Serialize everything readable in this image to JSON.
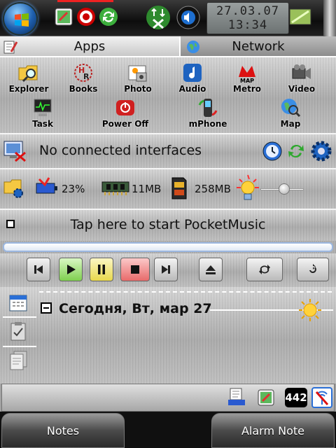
{
  "status_bar": {
    "date": "27.03.07",
    "time": "13:34"
  },
  "tabs": [
    {
      "label": "Apps",
      "icon": "notepad-icon",
      "selected": true
    },
    {
      "label": "Network",
      "icon": "globe-icon",
      "selected": false
    }
  ],
  "apps": [
    {
      "label": "Explorer",
      "icon": "folder-search-icon"
    },
    {
      "label": "Books",
      "icon": "books-icon"
    },
    {
      "label": "Photo",
      "icon": "photo-icon"
    },
    {
      "label": "Audio",
      "icon": "audio-note-icon"
    },
    {
      "label": "Metro",
      "icon": "metro-map-icon"
    },
    {
      "label": "Video",
      "icon": "video-camera-icon"
    },
    {
      "label": "Task",
      "icon": "task-manager-icon"
    },
    {
      "label": "Power Off",
      "icon": "power-icon"
    },
    {
      "label": "mPhone",
      "icon": "phone-icon"
    },
    {
      "label": "Map",
      "icon": "map-globe-icon"
    }
  ],
  "network": {
    "status_text": "No connected interfaces"
  },
  "system": {
    "battery": "23%",
    "ram": "11MB",
    "storage": "258MB",
    "brightness": 0.55
  },
  "music": {
    "prompt": "Tap here to start PocketMusic"
  },
  "today": {
    "title": "Сегодня, Вт, мар 27"
  },
  "tray": {
    "count": "442"
  },
  "softkeys": {
    "left": "Notes",
    "right": "Alarm Note"
  },
  "colors": {
    "accent_blue": "#1e5fae",
    "play_green": "#9be06a",
    "pause_yellow": "#f0e46a",
    "stop_red": "#f08080"
  }
}
